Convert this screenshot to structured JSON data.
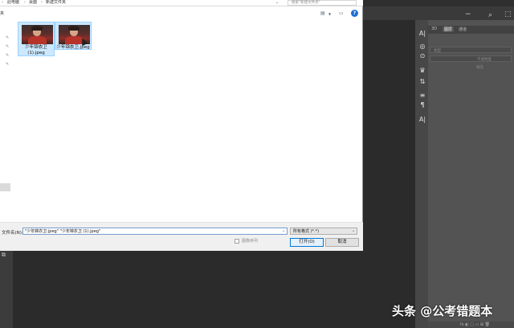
{
  "address_bar": {
    "crumbs": [
      "此电脑",
      "桌面",
      "新建文件夹"
    ],
    "search_placeholder": "搜索\"新建文件夹\""
  },
  "toolbar": {
    "new_folder_label": "夹",
    "view_icon": "view-options-icon",
    "pane_icon": "preview-pane-icon",
    "help_icon": "help-icon",
    "help_label": "?"
  },
  "nav_pane": {
    "pins": [
      "pin-icon",
      "pin-icon",
      "pin-icon",
      "pin-icon"
    ]
  },
  "files": [
    {
      "name": "少年锦衣卫\n(1).jpeg",
      "selected": true
    },
    {
      "name": "少年锦衣卫.jpeg",
      "selected": true
    }
  ],
  "bottom": {
    "filename_label": "文件名(N):",
    "filename_value": "\"少年锦衣卫.jpeg\" \"少年锦衣卫 (1).jpeg\"",
    "filter_value": "所有格式 (*.*)",
    "sequence_label": "图像序列",
    "open_label": "打开(O)",
    "cancel_label": "取消"
  },
  "photoshop": {
    "panel_tabs": [
      "3D",
      "图层",
      "通道"
    ],
    "active_tab": "图层",
    "row_placeholders": [
      "类型",
      "不透明度",
      "填充"
    ],
    "bottom_icons": "fx ◐ ▢ ▭ ⊞ 🗑",
    "tools": [
      "A|",
      "◎",
      "⊙",
      "♛",
      "⇅",
      "≡",
      "¶",
      "A|"
    ]
  },
  "watermark": {
    "text": "头条 @公考错题本"
  },
  "colors": {
    "selection_fill": "#cce8ff",
    "selection_border": "#99d1ff",
    "primary_border": "#0078d7",
    "ps_dark": "#2b2b2b"
  }
}
